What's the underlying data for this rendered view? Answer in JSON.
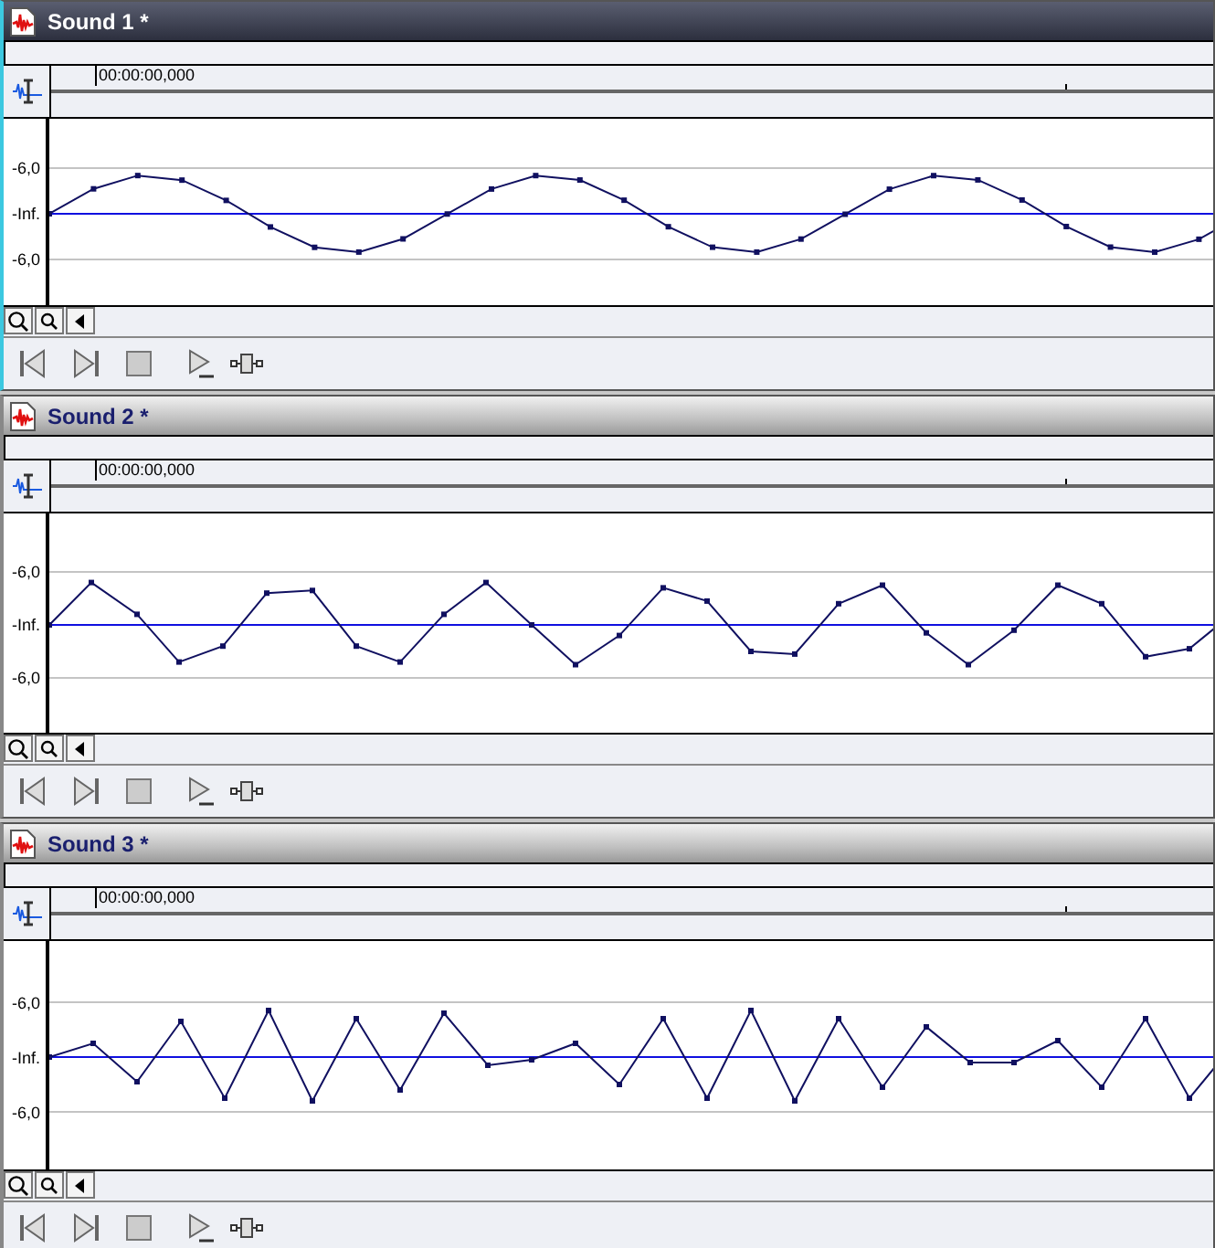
{
  "panels": [
    {
      "title": "Sound 1 *",
      "active": true,
      "time": "00:00:00,000",
      "y_labels": [
        "-6,0",
        "-Inf.",
        "-6,0"
      ]
    },
    {
      "title": "Sound 2 *",
      "active": false,
      "time": "00:00:00,000",
      "y_labels": [
        "-6,0",
        "-Inf.",
        "-6,0"
      ]
    },
    {
      "title": "Sound 3 *",
      "active": false,
      "time": "00:00:00,000",
      "y_labels": [
        "-6,0",
        "-Inf.",
        "-6,0"
      ]
    }
  ]
}
